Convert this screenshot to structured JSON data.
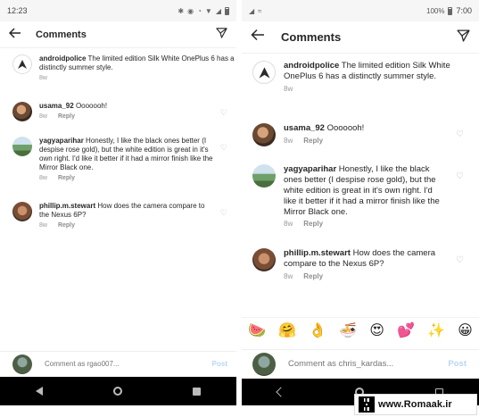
{
  "left": {
    "status": {
      "time": "12:23"
    },
    "header": {
      "title": "Comments"
    },
    "comments": [
      {
        "user": "androidpolice",
        "text": "The limited edition Silk White OnePlus 6 has a distinctly summer style.",
        "age": "8w",
        "reply": ""
      },
      {
        "user": "usama_92",
        "text": "Ooooooh!",
        "age": "8w",
        "reply": "Reply"
      },
      {
        "user": "yagyaparihar",
        "text": "Honestly, I like the black ones better (I despise rose gold), but the white edition is great in it's own right. I'd like it better if it had a mirror finish like the Mirror Black one.",
        "age": "8w",
        "reply": "Reply"
      },
      {
        "user": "phillip.m.stewart",
        "text": "How does the camera compare to the Nexus 6P?",
        "age": "8w",
        "reply": "Reply"
      }
    ],
    "composer": {
      "placeholder": "Comment as rgao007...",
      "post_label": "Post"
    }
  },
  "right": {
    "status": {
      "battery": "100%",
      "time": "7:00"
    },
    "header": {
      "title": "Comments"
    },
    "comments": [
      {
        "user": "androidpolice",
        "text": "The limited edition Silk White OnePlus 6 has a distinctly summer style.",
        "age": "8w",
        "reply": ""
      },
      {
        "user": "usama_92",
        "text": "Ooooooh!",
        "age": "8w",
        "reply": "Reply"
      },
      {
        "user": "yagyaparihar",
        "text": "Honestly, I like the black ones better (I despise rose gold), but the white edition is great in it's own right. I'd like it better if it had a mirror finish like the Mirror Black one.",
        "age": "8w",
        "reply": "Reply"
      },
      {
        "user": "phillip.m.stewart",
        "text": "How does the camera compare to the Nexus 6P?",
        "age": "8w",
        "reply": "Reply"
      }
    ],
    "emoji_bar": [
      "🍉",
      "🤗",
      "👌",
      "🍜",
      "😍",
      "💕",
      "✨",
      "😀"
    ],
    "composer": {
      "placeholder": "Comment as chris_kardas...",
      "post_label": "Post"
    }
  },
  "watermark": {
    "text": "www.Romaak.ir"
  },
  "icons": {
    "back": "back-arrow-icon",
    "direct": "paper-plane-icon",
    "heart": "heart-outline-icon"
  },
  "colors": {
    "post_disabled": "#b8d6f5",
    "navbar": "#000000",
    "meta_gray": "#999999"
  }
}
